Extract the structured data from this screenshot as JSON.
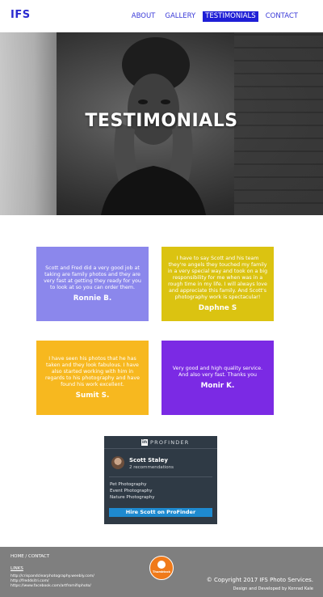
{
  "nav": {
    "brand": "IFS",
    "links": [
      "ABOUT",
      "GALLERY",
      "TESTIMONIALS",
      "CONTACT"
    ],
    "active_link": "TESTIMONIALS"
  },
  "hero": {
    "title": "TESTIMONIALS"
  },
  "testimonials": [
    {
      "text": "Scott and Fred did a very good job at taking are family photos and they are very fast at getting they ready for you to look at so you can order them.",
      "name": "Ronnie B.",
      "color": "#8b87ec"
    },
    {
      "text": "I have to say Scott and his team they're angels they touched my family in a very special way and took on a big responsibility for me when was in a rough time in my life. I will always love and appreciate this family. And Scott's photography work is spectacular!",
      "name": "Daphne S",
      "color": "#dbc311"
    },
    {
      "text": "I have seen his photos that he has taken and they look fabulous. I have also started working with him in regards to his photography and have found his work excellent.",
      "name": "Sumit S.",
      "color": "#f7b81f"
    },
    {
      "text": "Very good and high quality service. And also very fast. Thanks you",
      "name": "Monir K.",
      "color": "#7b2ae4"
    }
  ],
  "profinder": {
    "logo": "in",
    "brand": "PROFINDER",
    "name": "Scott Staley",
    "recommendations": "2 recommendations",
    "services": [
      "Pet Photography",
      "Event Photography",
      "Nature Photography"
    ],
    "button": "Hire Scott on ProFinder"
  },
  "footer": {
    "nav": "HOME / CONTACT",
    "links_heading": "LINKS",
    "links": [
      "http://crispandclearphotography.weebly.com/",
      "http://freddsitri.com/",
      "https://www.facebook.com/artfromifsphoto/"
    ],
    "badge_text": "Thumbtack",
    "copyright": "© Copyright 2017 IFS Photo Services.",
    "developer": "Design and Developed by Konrad Kale"
  },
  "colors": {
    "nav_accent": "#1f1fd6",
    "footer_bg": "#7f7f7f",
    "profinder_bg": "#2f3a45",
    "profinder_button": "#1e8ad0"
  }
}
